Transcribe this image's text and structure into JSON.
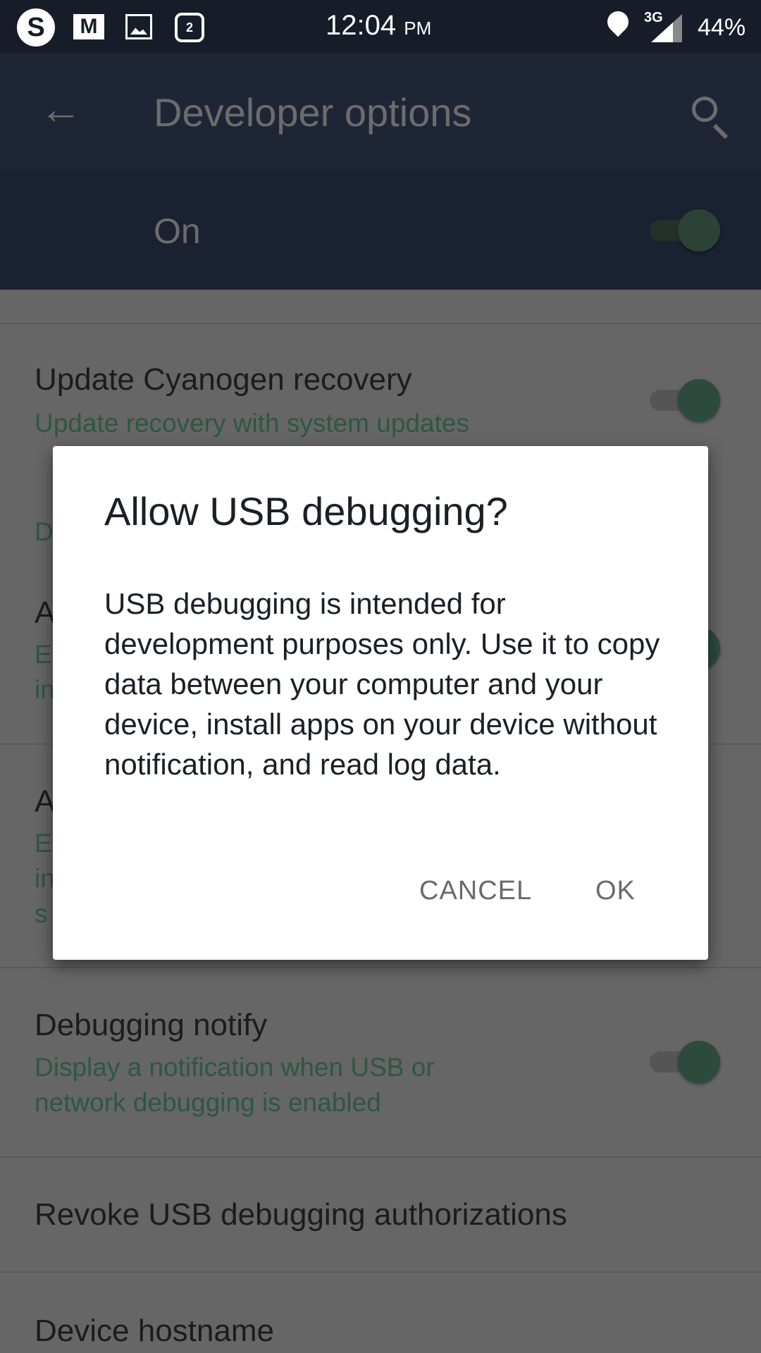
{
  "status_bar": {
    "time": "12:04",
    "ampm": "PM",
    "network": "3G",
    "battery": "44%",
    "notification_badge": "2",
    "icons": [
      "skype-icon",
      "gmail-icon",
      "gallery-icon",
      "instagram-icon",
      "location-icon",
      "signal-icon"
    ]
  },
  "app_bar": {
    "title": "Developer options",
    "back_icon": "arrow-back-icon",
    "search_icon": "search-icon"
  },
  "master_switch": {
    "label": "On",
    "checked": true
  },
  "settings": {
    "update_recovery": {
      "title": "Update Cyanogen recovery",
      "subtitle": "Update recovery with system updates",
      "checked": true
    },
    "obscured": {
      "section_fragment": "D",
      "item1_title": "A",
      "item1_l1": "E",
      "item1_l2": "in",
      "item2_title": "A",
      "item2_l1": "E",
      "item2_l2": "in",
      "item2_l3": "s"
    },
    "debugging_notify": {
      "title": "Debugging notify",
      "subtitle_l1": "Display a notification when USB or",
      "subtitle_l2": "network debugging is enabled",
      "checked": true
    },
    "revoke": {
      "title": "Revoke USB debugging authorizations"
    },
    "hostname": {
      "title": "Device hostname"
    }
  },
  "dialog": {
    "title": "Allow USB debugging?",
    "body": "USB debugging is intended for development purposes only. Use it to copy data between your computer and your device, install apps on your device without notification, and read log data.",
    "cancel": "CANCEL",
    "ok": "OK"
  },
  "colors": {
    "accent": "#2c4b3d",
    "app_bar": "#1e2636",
    "scrim_bg": "#666666"
  }
}
